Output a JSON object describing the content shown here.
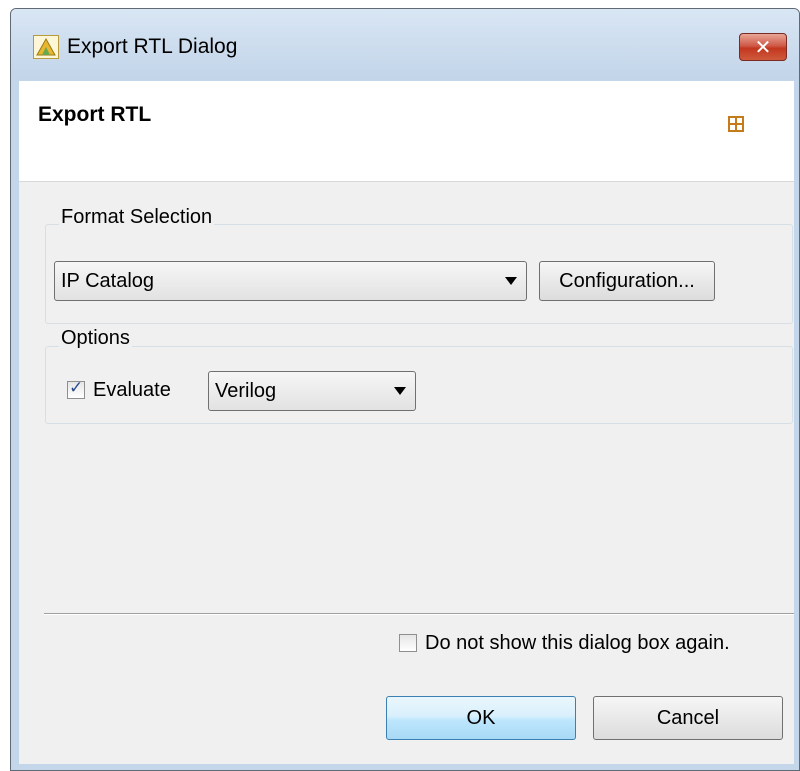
{
  "window": {
    "title": "Export RTL Dialog",
    "close_label": "✕"
  },
  "header": {
    "title": "Export RTL"
  },
  "format_selection": {
    "group_label": "Format Selection",
    "selected_format": "IP Catalog",
    "configuration_label": "Configuration..."
  },
  "options": {
    "group_label": "Options",
    "evaluate_label": "Evaluate",
    "evaluate_checked": true,
    "language": "Verilog"
  },
  "footer": {
    "dont_show_label": "Do not show this dialog box again.",
    "dont_show_checked": false,
    "ok_label": "OK",
    "cancel_label": "Cancel"
  },
  "icons": {
    "app": "vivado-hls-icon",
    "wizard": "grid-icon",
    "close": "close-icon",
    "checkmark": "checkmark-icon",
    "dropdown": "chevron-down-icon"
  },
  "colors": {
    "title_bar": "#c3d6ea",
    "close_button": "#c2381f",
    "default_button": "#bee6fd",
    "dialog_bg": "#f0f0f0"
  }
}
